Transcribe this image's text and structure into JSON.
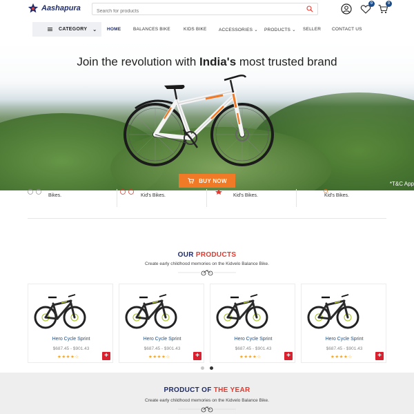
{
  "header": {
    "brand": "Aashapura",
    "search_placeholder": "Search for products",
    "wishlist_count": "0",
    "cart_count": "0"
  },
  "nav": {
    "category_label": "CATEGORY",
    "items": [
      "HOME",
      "BALANCES BIKE",
      "KIDS BIKE",
      "ACCESSORIES",
      "PRODUCTS",
      "SELLER",
      "CONTACT US"
    ]
  },
  "hero": {
    "title_pre": "Join the revolution with ",
    "title_bold": "India's",
    "title_post": " most trusted brand",
    "buy_label": "BUY NOW",
    "tnc": "*T&C App",
    "bike_accent_color": "#f07a26"
  },
  "features": [
    {
      "text": "Bikes."
    },
    {
      "text": "Kid's Bikes."
    },
    {
      "text": "Kid's Bikes."
    },
    {
      "text": "Kid's Bikes."
    }
  ],
  "our_products": {
    "title_a": "OUR ",
    "title_b": "PRODUCTS",
    "subtitle": "Create early childhood memories on the Kidvelo Balance Bike.",
    "items": [
      {
        "name": "Hero Cycle Sprint",
        "price": "$687.45 - $901.43",
        "stars": "★★★★☆"
      },
      {
        "name": "Hero Cycle Sprint",
        "price": "$687.45 - $901.43",
        "stars": "★★★★☆"
      },
      {
        "name": "Hero Cycle Sprint",
        "price": "$687.45 - $901.43",
        "stars": "★★★★☆"
      },
      {
        "name": "Hero Cycle Sprint",
        "price": "$687.45 - $901.43",
        "stars": "★★★★☆"
      }
    ],
    "add_symbol": "+"
  },
  "product_of_year": {
    "title_a": "PRODUCT OF ",
    "title_b": "THE YEAR",
    "subtitle": "Create early childhood memories on the Kidvelo Balance Bike."
  },
  "colors": {
    "brand_navy": "#1d2b6b",
    "accent_red": "#e03a2f",
    "buy_orange": "#f07a26",
    "badge_blue": "#1d4e89"
  }
}
